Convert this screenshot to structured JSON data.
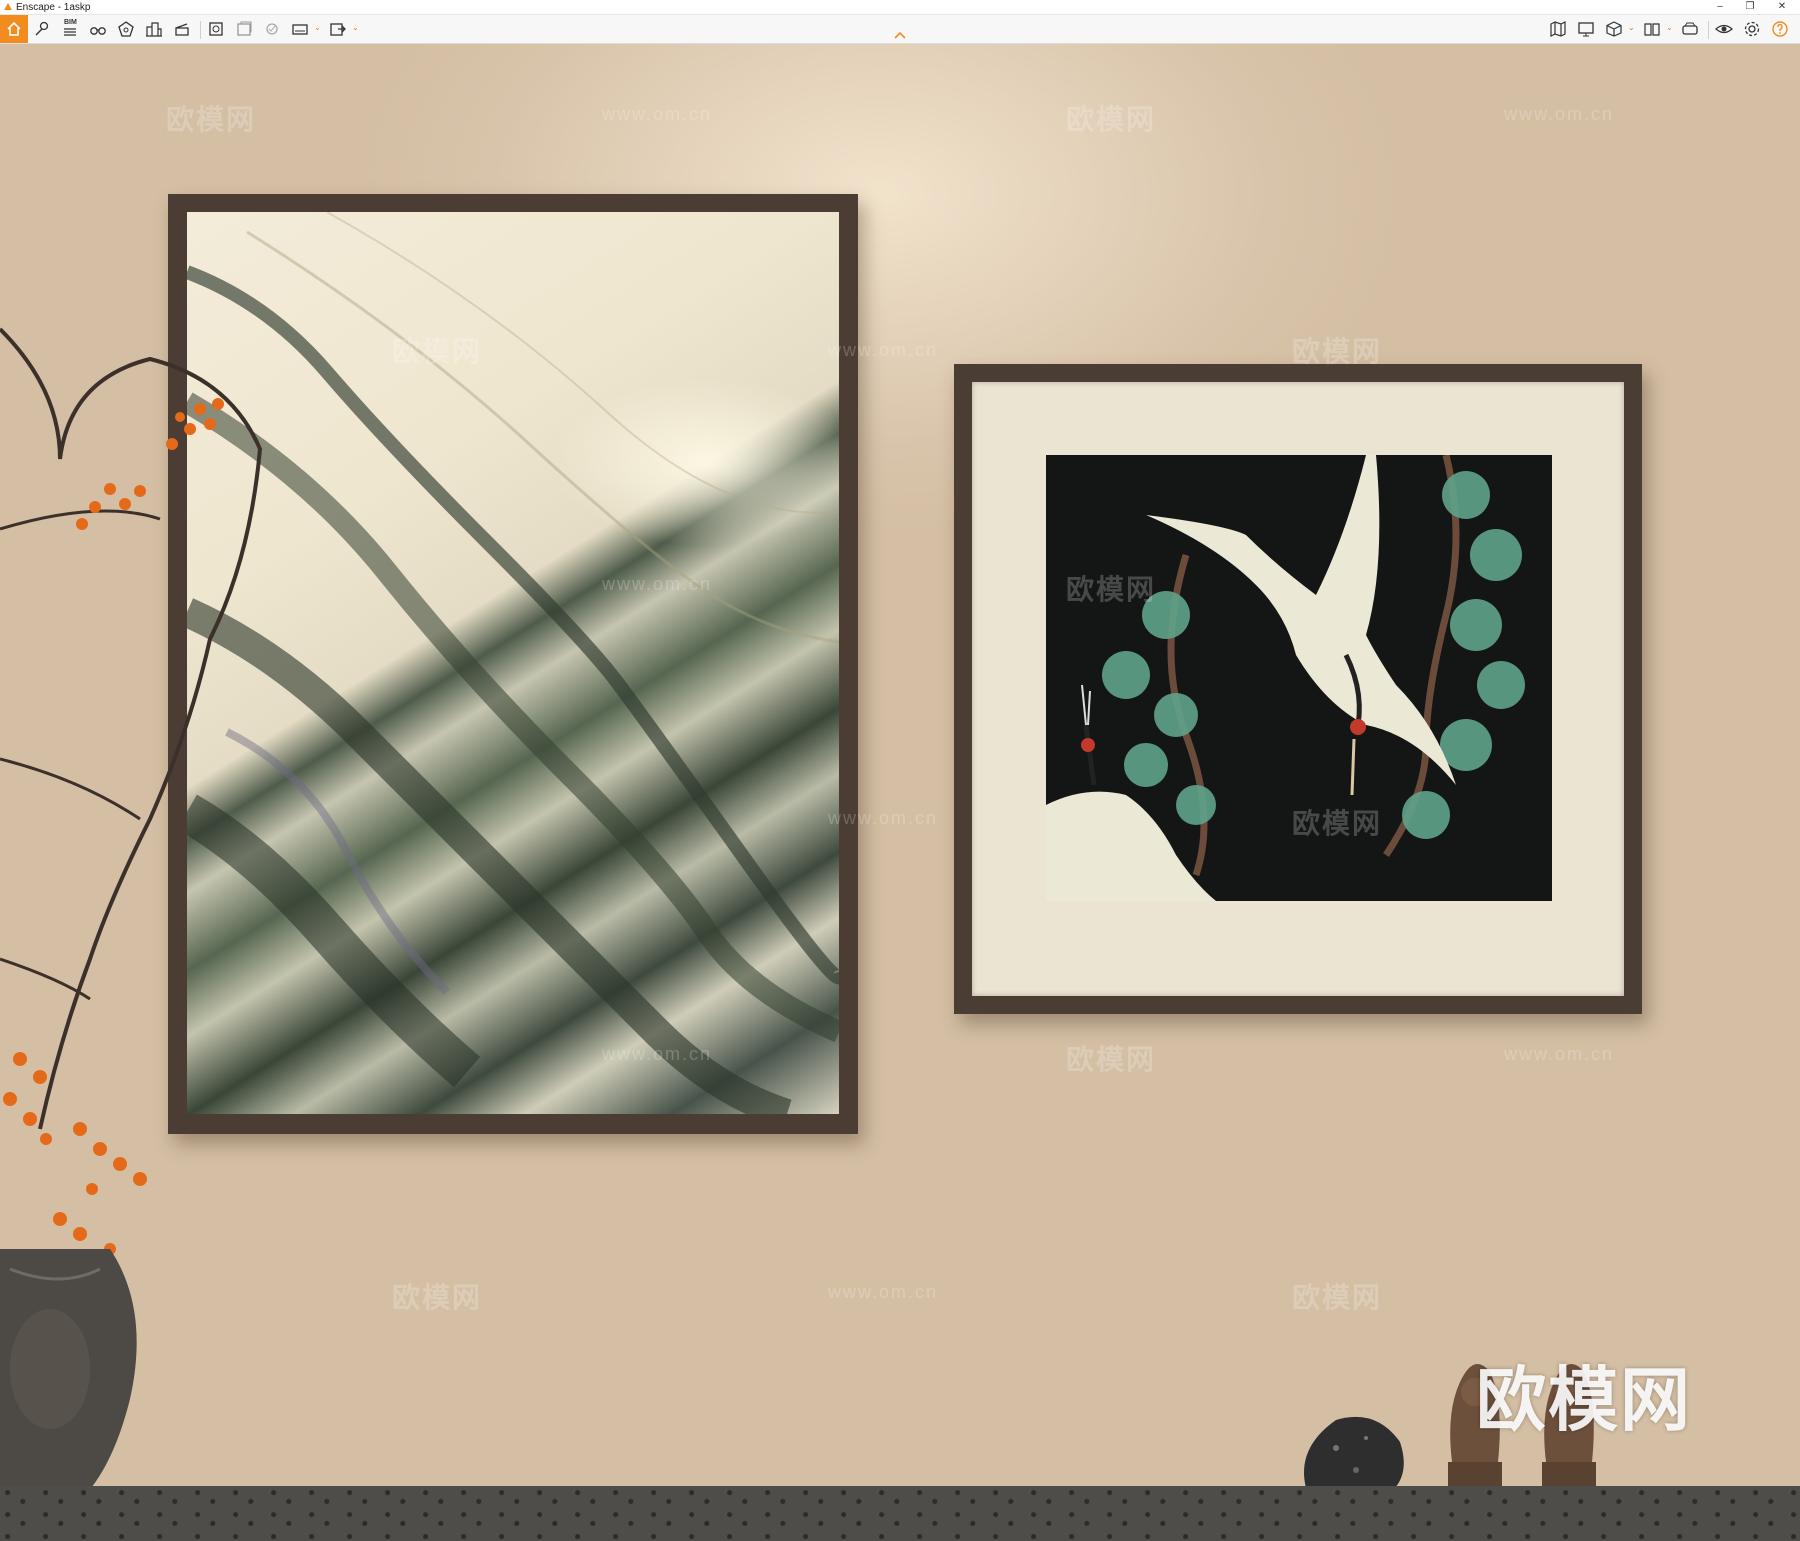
{
  "window": {
    "title": "Enscape - 1askp",
    "minimize": "–",
    "restore": "❐",
    "close": "✕"
  },
  "toolbar": {
    "bim_label": "BIM",
    "tools_left": [
      "home-icon",
      "pin-icon",
      "list-icon",
      "binoculars-icon",
      "pentagon-icon",
      "buildings-icon",
      "clapper-icon",
      "render-icon",
      "batch-render-icon",
      "sun-icon",
      "panorama-icon",
      "export-icon"
    ],
    "tools_right": [
      "map-icon",
      "monitor-icon",
      "cube-icon",
      "book-icon",
      "vr-headset-icon",
      "eye-icon",
      "gear-icon",
      "help-icon"
    ],
    "accent": "#f28c1e"
  },
  "watermarks": {
    "brand": "欧模网",
    "url": "www.om.cn"
  }
}
